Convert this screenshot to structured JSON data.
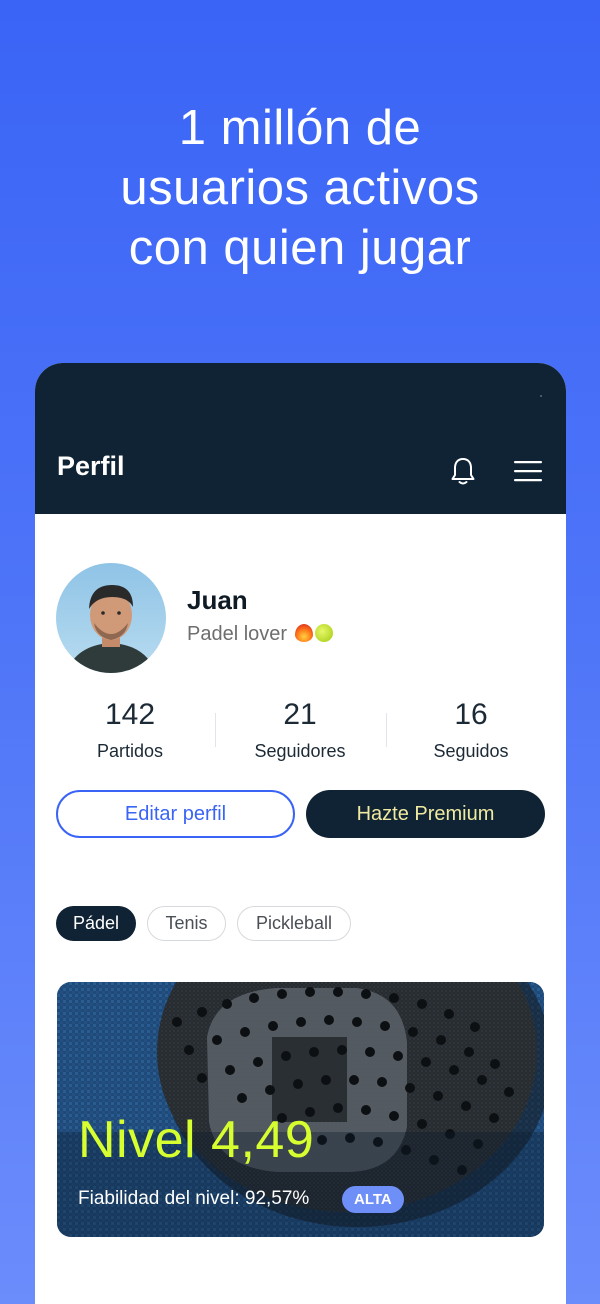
{
  "headline": {
    "line1": "1 millón de",
    "line2": "usuarios activos",
    "line3": "con quien jugar"
  },
  "app": {
    "screen_title": "Perfil",
    "icons": {
      "notifications": "bell-icon",
      "menu": "hamburger-menu-icon"
    }
  },
  "profile": {
    "name": "Juan",
    "bio": "Padel lover",
    "bio_emojis": [
      "fire-emoji",
      "tennis-ball-emoji"
    ]
  },
  "stats": [
    {
      "value": "142",
      "label": "Partidos"
    },
    {
      "value": "21",
      "label": "Seguidores"
    },
    {
      "value": "16",
      "label": "Seguidos"
    }
  ],
  "actions": {
    "edit_profile": "Editar perfil",
    "go_premium": "Hazte Premium"
  },
  "sports_tabs": [
    {
      "label": "Pádel",
      "selected": true
    },
    {
      "label": "Tenis",
      "selected": false
    },
    {
      "label": "Pickleball",
      "selected": false
    }
  ],
  "level_card": {
    "level_text": "Nivel 4,49",
    "reliability_text": "Fiabilidad del nivel: 92,57%",
    "reliability_badge": "ALTA"
  },
  "colors": {
    "background": "#3a64f6",
    "header": "#0f2334",
    "accent_blue": "#3a64f6",
    "premium_text": "#f0e9a0",
    "level_text": "#d7ff2f",
    "badge": "#6f8ff8"
  }
}
